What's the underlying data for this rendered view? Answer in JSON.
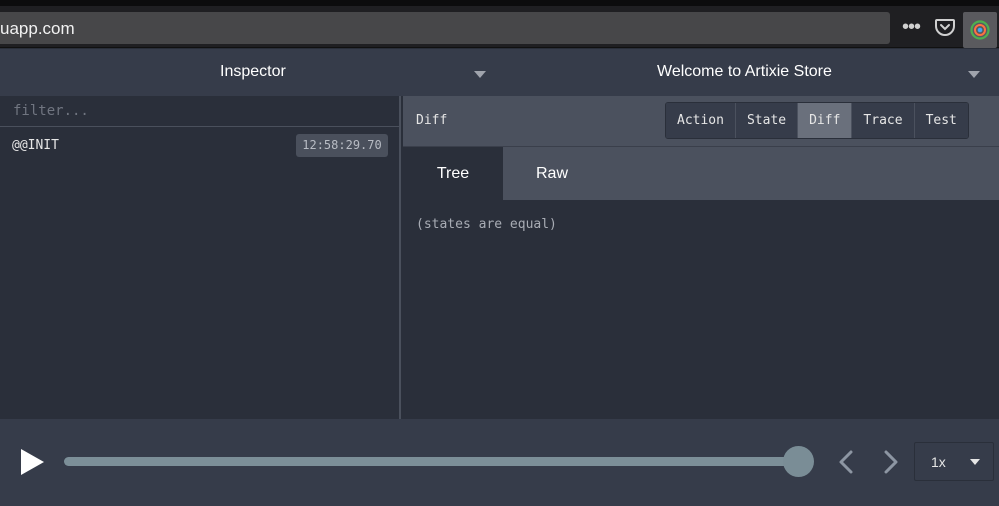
{
  "browser": {
    "url": "uapp.com",
    "menu_icon": "dots-icon",
    "pocket_icon": "pocket-icon",
    "extension_icon": "redux-devtools-icon"
  },
  "header": {
    "monitor_title": "Inspector",
    "store_title": "Welcome to Artixie Store"
  },
  "actions": {
    "filter_placeholder": "filter...",
    "items": [
      {
        "name": "@@INIT",
        "time": "12:58:29.70"
      }
    ]
  },
  "detail": {
    "toolbar_label": "Diff",
    "tabs": [
      {
        "label": "Action",
        "active": false
      },
      {
        "label": "State",
        "active": false
      },
      {
        "label": "Diff",
        "active": true
      },
      {
        "label": "Trace",
        "active": false
      },
      {
        "label": "Test",
        "active": false
      }
    ],
    "subtabs": [
      {
        "label": "Tree",
        "active": true
      },
      {
        "label": "Raw",
        "active": false
      }
    ],
    "content": "(states are equal)"
  },
  "slider": {
    "position": 1.0,
    "speed": "1x"
  },
  "colors": {
    "background": "#2a2f3a",
    "header": "#363c4a",
    "toolbar": "#4b515e",
    "accent": "#7c8f98"
  }
}
